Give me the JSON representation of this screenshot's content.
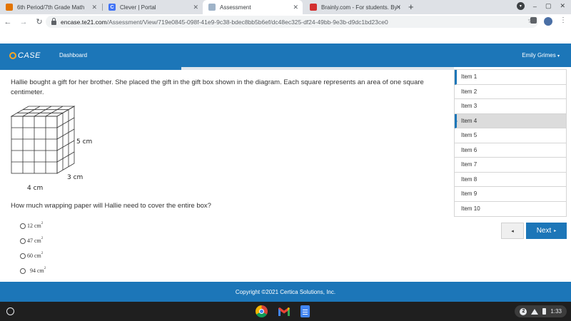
{
  "browser": {
    "tabs": [
      {
        "title": "6th Period/7th Grade Math",
        "favicon_color": "#e37400"
      },
      {
        "title": "Clever | Portal",
        "favicon_color": "#4274f6",
        "favicon_letter": "C"
      },
      {
        "title": "Assessment",
        "favicon_color": "#9fb3c8"
      },
      {
        "title": "Brainly.com - For students. By st",
        "favicon_color": "#d32f2f"
      }
    ],
    "active_tab": 2,
    "url_host": "encase.te21.com",
    "url_path": "/Assessment/View/719e0845-098f-41e9-9c38-bdec8bb5b6ef/dc48ec325-df24-49bb-9e3b-d9dc1bd23ce0",
    "icons": [
      "back-icon",
      "forward-icon",
      "reload-icon",
      "lock-icon",
      "star-icon",
      "puzzle-icon",
      "profile-avatar",
      "menu-icon"
    ]
  },
  "app": {
    "logo_text": "CASE",
    "nav_dashboard": "Dashboard",
    "user_name": "Emily Grimes",
    "accent_color": "#1c76b8",
    "progress_fraction": 0.4
  },
  "question": {
    "text": "Hallie bought a gift for her brother. She placed the gift in the gift box shown in the diagram. Each square represents an area of one square centimeter.",
    "diagram": {
      "width_label": "4 cm",
      "height_label": "5 cm",
      "depth_label": "3 cm"
    },
    "prompt": "How much wrapping paper will Hallie need to cover the entire box?",
    "choices": [
      {
        "value": "12 cm",
        "exp": "2"
      },
      {
        "value": "47 cm",
        "exp": "2"
      },
      {
        "value": "60 cm",
        "exp": "2"
      },
      {
        "value": "94 cm",
        "exp": "2"
      }
    ]
  },
  "items": [
    "Item 1",
    "Item 2",
    "Item 3",
    "Item 4",
    "Item 5",
    "Item 6",
    "Item 7",
    "Item 8",
    "Item 9",
    "Item 10"
  ],
  "current_item_index": 3,
  "nav": {
    "prev_label": "◂",
    "next_label": "Next",
    "next_arrow": "▸"
  },
  "footer": {
    "copyright": "Copyright ©2021 Certica Solutions, Inc."
  },
  "shelf": {
    "apps": [
      "chrome-icon",
      "gmail-icon",
      "docs-icon"
    ],
    "notification_count": "2",
    "time": "1:33"
  }
}
